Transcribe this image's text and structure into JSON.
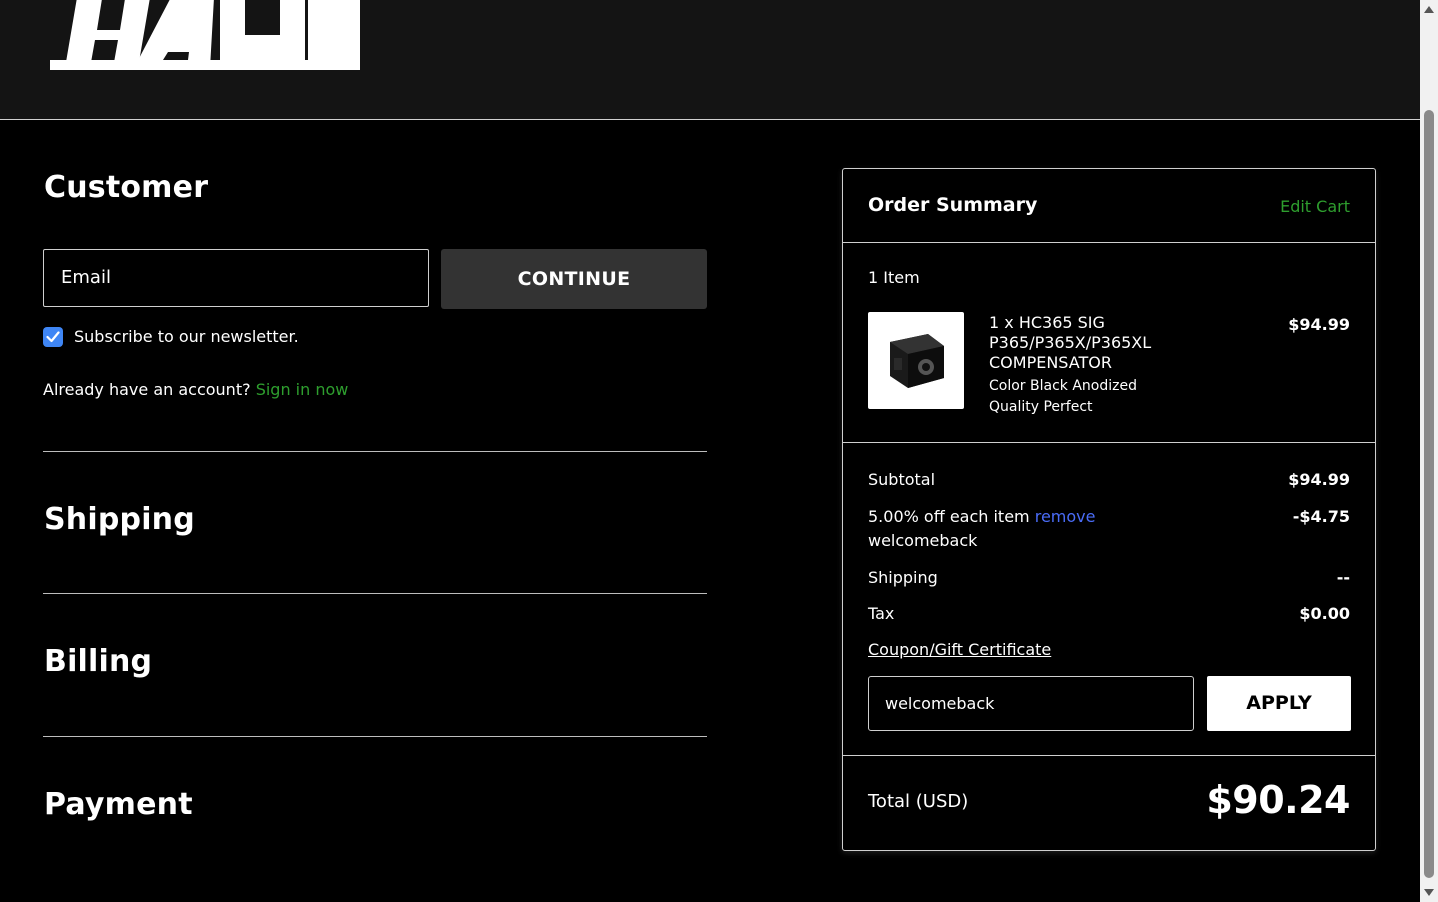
{
  "header": {
    "logo_text": "HACK"
  },
  "customer": {
    "title": "Customer",
    "email_placeholder": "Email",
    "continue_label": "CONTINUE",
    "subscribe_label": "Subscribe to our newsletter.",
    "subscribe_checked": true,
    "account_prompt": "Already have an account?",
    "sign_in_label": "Sign in now"
  },
  "sections": {
    "shipping": "Shipping",
    "billing": "Billing",
    "payment": "Payment"
  },
  "order_summary": {
    "title": "Order Summary",
    "edit_cart": "Edit Cart",
    "items_count": "1 Item",
    "product": {
      "name": "1 x HC365 SIG P365/P365X/P365XL COMPENSATOR",
      "option_color": "Color Black Anodized",
      "option_quality": "Quality Perfect",
      "price": "$94.99"
    },
    "subtotal_label": "Subtotal",
    "subtotal_value": "$94.99",
    "discount_label": "5.00% off each item",
    "discount_remove": "remove",
    "discount_code": "welcomeback",
    "discount_value": "-$4.75",
    "shipping_label": "Shipping",
    "shipping_value": "--",
    "tax_label": "Tax",
    "tax_value": "$0.00",
    "coupon_link": "Coupon/Gift Certificate",
    "coupon_value": "welcomeback",
    "apply_label": "APPLY",
    "total_label": "Total (USD)",
    "total_value": "$90.24"
  },
  "colors": {
    "accent_green": "#2e9e2e",
    "remove_link_blue": "#4a6cf7",
    "checkbox_blue": "#3f86f5",
    "button_dark": "#333333"
  }
}
